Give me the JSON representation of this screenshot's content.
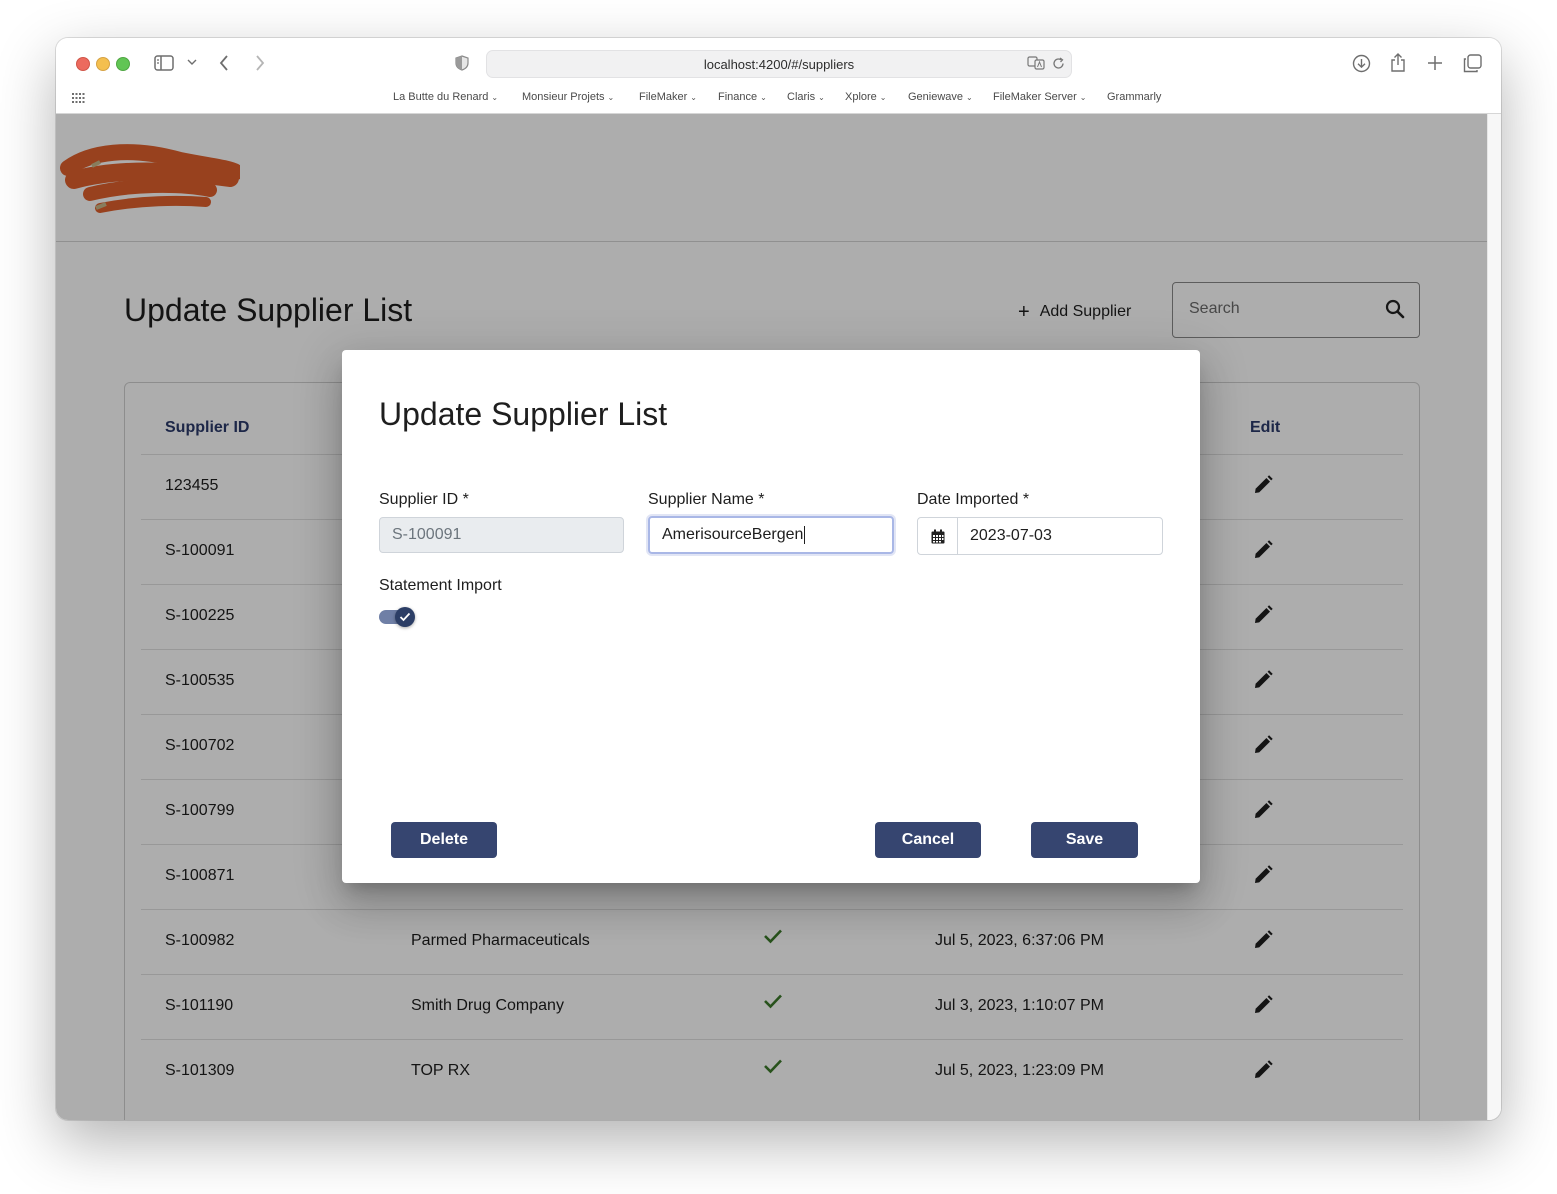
{
  "browser": {
    "url": "localhost:4200/#/suppliers",
    "bookmarks": [
      "La Butte du Renard",
      "Monsieur Projets",
      "FileMaker",
      "Finance",
      "Claris",
      "Xplore",
      "Geniewave",
      "FileMaker Server",
      "Grammarly"
    ]
  },
  "page": {
    "title": "Update Supplier List",
    "add_supplier_label": "Add Supplier",
    "search_placeholder": "Search",
    "table": {
      "columns": {
        "id": "Supplier ID",
        "edit": "Edit"
      },
      "rows": [
        {
          "id": "123455",
          "name": "",
          "imported": false,
          "date": ""
        },
        {
          "id": "S-100091",
          "name": "",
          "imported": false,
          "date": ""
        },
        {
          "id": "S-100225",
          "name": "",
          "imported": false,
          "date": ""
        },
        {
          "id": "S-100535",
          "name": "",
          "imported": false,
          "date": ""
        },
        {
          "id": "S-100702",
          "name": "",
          "imported": false,
          "date": ""
        },
        {
          "id": "S-100799",
          "name": "",
          "imported": false,
          "date": ""
        },
        {
          "id": "S-100871",
          "name": "",
          "imported": false,
          "date": ""
        },
        {
          "id": "S-100982",
          "name": "Parmed Pharmaceuticals",
          "imported": true,
          "date": "Jul 5, 2023, 6:37:06 PM"
        },
        {
          "id": "S-101190",
          "name": "Smith Drug Company",
          "imported": true,
          "date": "Jul 3, 2023, 1:10:07 PM"
        },
        {
          "id": "S-101309",
          "name": "TOP RX",
          "imported": true,
          "date": "Jul 5, 2023, 1:23:09 PM"
        }
      ]
    }
  },
  "dialog": {
    "title": "Update Supplier List",
    "supplier_id_label": "Supplier ID *",
    "supplier_id_value": "S-100091",
    "supplier_name_label": "Supplier Name *",
    "supplier_name_value": "AmerisourceBergen",
    "date_label": "Date Imported *",
    "date_value": "2023-07-03",
    "statement_import_label": "Statement Import",
    "statement_import_on": true,
    "delete_label": "Delete",
    "cancel_label": "Cancel",
    "save_label": "Save"
  },
  "colors": {
    "primary_button": "#364570",
    "table_header_text": "#2b3a6b",
    "check_green": "#3c7a2a",
    "logo_scribble": "#e0612d"
  }
}
